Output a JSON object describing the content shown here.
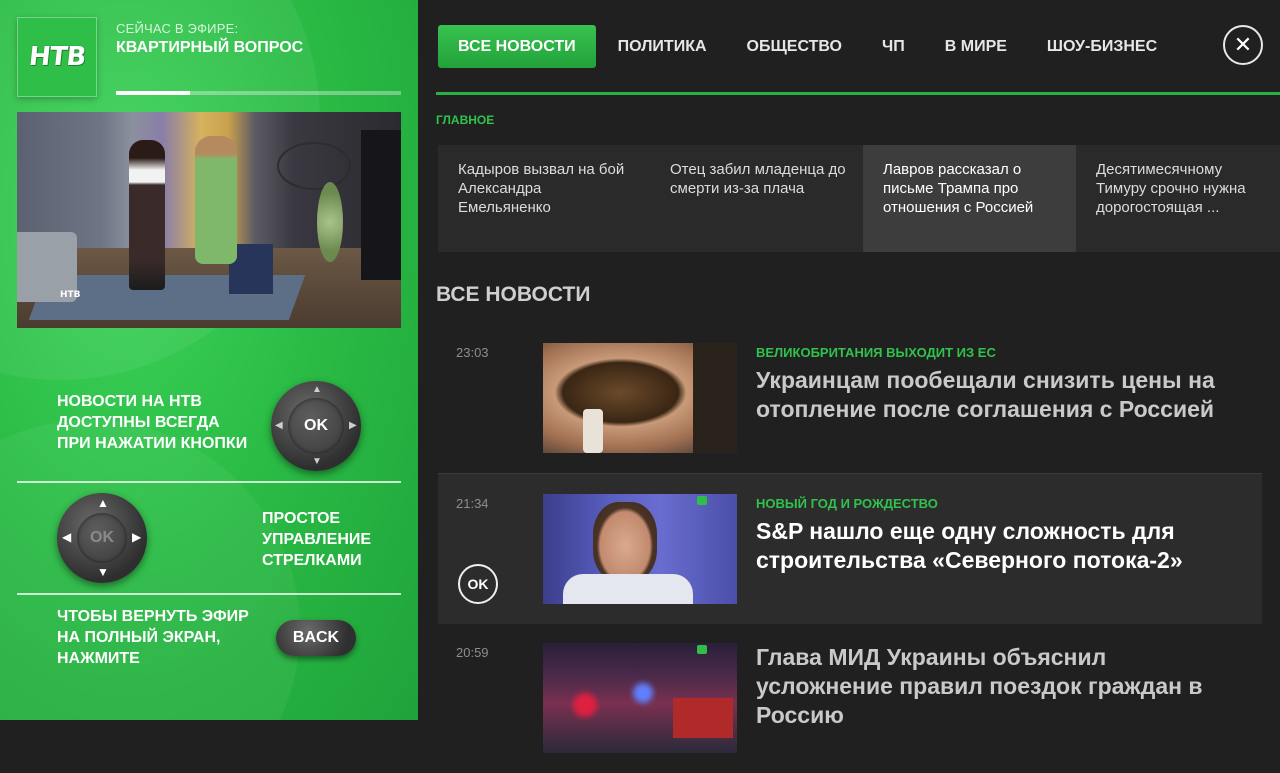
{
  "sidebar": {
    "logo": "НТВ",
    "onair_label": "СЕЙЧАС В ЭФИРЕ:",
    "onair_title": "КВАРТИРНЫЙ ВОПРОС",
    "progress": 0.26,
    "video_watermark": "НТВ",
    "help_ok": [
      "НОВОСТИ НА НТВ",
      "ДОСТУПНЫ ВСЕГДА",
      "ПРИ НАЖАТИИ КНОПКИ"
    ],
    "ok_label": "OK",
    "help_arrows": [
      "ПРОСТОЕ",
      "УПРАВЛЕНИЕ",
      "СТРЕЛКАМИ"
    ],
    "arrows_ok_label": "OK",
    "help_back": [
      "ЧТОБЫ ВЕРНУТЬ ЭФИР",
      "НА ПОЛНЫЙ ЭКРАН,",
      "НАЖМИТЕ"
    ],
    "back_label": "BACK"
  },
  "tabs": [
    {
      "label": "ВСЕ НОВОСТИ",
      "active": true
    },
    {
      "label": "ПОЛИТИКА"
    },
    {
      "label": "ОБЩЕСТВО"
    },
    {
      "label": "ЧП"
    },
    {
      "label": "В МИРЕ"
    },
    {
      "label": "ШОУ-БИЗНЕС"
    }
  ],
  "close_icon": "close-icon",
  "main_section": "ГЛАВНОЕ",
  "main_cards": [
    "Кадыров вызвал на бой Александра Емельяненко",
    "Отец забил младенца до смерти из-за плача",
    "Лавров рассказал о письме Трампа про отношения с Россией",
    "Десятимесячному Тимуру срочно нужна дорогостоящая ..."
  ],
  "all_news_title": "ВСЕ НОВОСТИ",
  "news": [
    {
      "time": "23:03",
      "category": "ВЕЛИКОБРИТАНИЯ ВЫХОДИТ ИЗ ЕС",
      "headline": "Украинцам пообещали снизить цены на отопление после соглашения с Россией"
    },
    {
      "time": "21:34",
      "category": "НОВЫЙ ГОД И РОЖДЕСТВО",
      "headline": "S&P нашло еще одну сложность для строительства «Северного потока-2»",
      "ok": "OK"
    },
    {
      "time": "20:59",
      "category": "",
      "headline": "Глава МИД Украины объяснил усложнение правил поездок граждан в Россию"
    }
  ]
}
